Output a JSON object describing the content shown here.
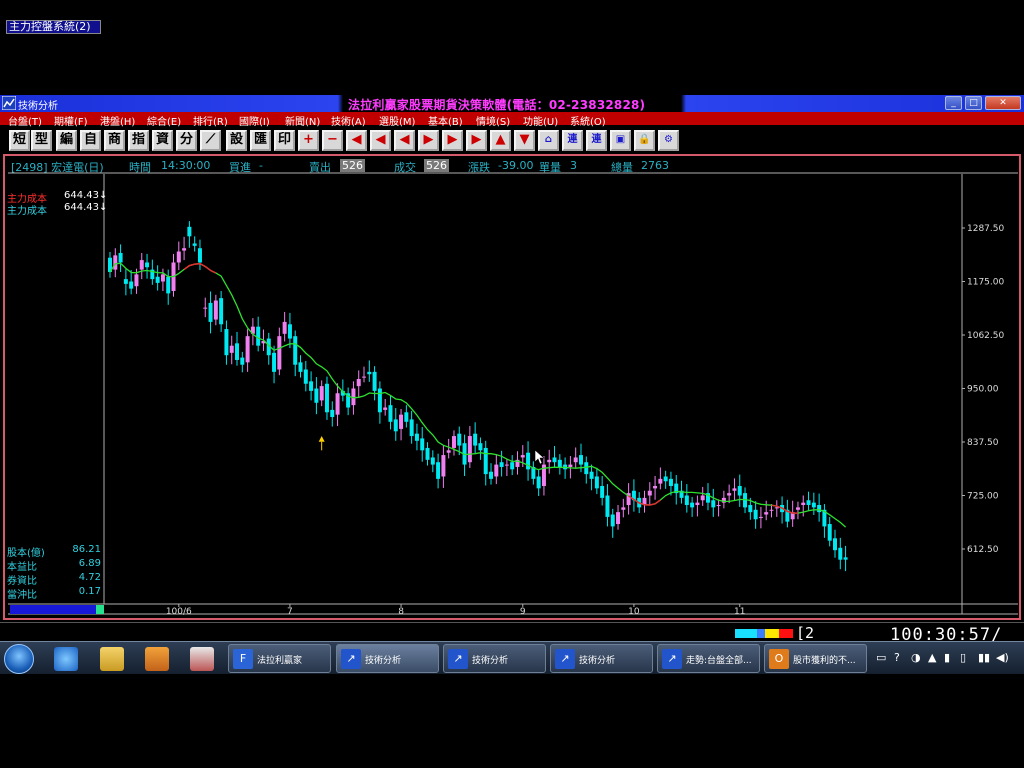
{
  "window": {
    "title": "技術分析",
    "banner": "法拉利贏家股票期貨決策軟體(電話：02-23832828)",
    "min_icon": "_",
    "max_icon": "□",
    "close_icon": "✕"
  },
  "menu": [
    {
      "label": "台盤(T)",
      "x": 8
    },
    {
      "label": "期權(F)",
      "x": 54
    },
    {
      "label": "港盤(H)",
      "x": 100
    },
    {
      "label": "綜合(E)",
      "x": 147
    },
    {
      "label": "排行(R)",
      "x": 193
    },
    {
      "label": "國際(I)",
      "x": 239
    },
    {
      "label": "新聞(N)",
      "x": 285
    },
    {
      "label": "技術(A)",
      "x": 331
    },
    {
      "label": "選股(M)",
      "x": 379
    },
    {
      "label": "基本(B)",
      "x": 428
    },
    {
      "label": "情境(S)",
      "x": 476
    },
    {
      "label": "功能(U)",
      "x": 523
    },
    {
      "label": "系統(O)",
      "x": 570
    }
  ],
  "toolbar": [
    "短",
    "型",
    "編",
    "自",
    "商",
    "指",
    "資",
    "分",
    "⟋",
    "設",
    "匯",
    "印",
    "+",
    "−",
    "◀",
    "◀",
    "◀",
    "▶",
    "▶",
    "▶",
    "▲",
    "▼",
    "⌂",
    "連",
    "連",
    "▣",
    "🔒",
    "⚙"
  ],
  "info": {
    "stock": "[2498] 宏達電(日)",
    "time_label": "時間",
    "time": "14:30:00",
    "bid_label": "買進",
    "bid": "-",
    "ask_label": "賣出",
    "ask": "526",
    "deal_label": "成交",
    "deal": "526",
    "change_label": "漲跌",
    "change": "-39.00",
    "vol_label": "單量",
    "vol": "3",
    "total_label": "總量",
    "total": "2763"
  },
  "indicator": {
    "title": "主力控盤系統(2)",
    "rows": [
      {
        "label": "主力成本",
        "value": "644.43↓"
      },
      {
        "label": "主力成本",
        "value": "644.43↓"
      }
    ]
  },
  "stats": [
    {
      "label": "股本(億)",
      "value": "86.21"
    },
    {
      "label": "本益比",
      "value": "6.89"
    },
    {
      "label": "券資比",
      "value": "4.72"
    },
    {
      "label": "當沖比",
      "value": "0.17"
    }
  ],
  "status": {
    "text": "[2_",
    "clock": "100:30:57/"
  },
  "taskbar": {
    "tasks": [
      {
        "label": "法拉利贏家",
        "x": 228,
        "color": "#2a64d6",
        "icon": "F"
      },
      {
        "label": "技術分析",
        "x": 336,
        "color": "#2255cc",
        "icon": "↗"
      },
      {
        "label": "技術分析",
        "x": 443,
        "color": "#2255cc",
        "icon": "↗"
      },
      {
        "label": "技術分析",
        "x": 550,
        "color": "#2255cc",
        "icon": "↗"
      },
      {
        "label": "走勢:台盤全部...",
        "x": 657,
        "color": "#2255cc",
        "icon": "↗"
      },
      {
        "label": "股市獲利的不...",
        "x": 764,
        "color": "#e07b1c",
        "icon": "O"
      }
    ],
    "tray": [
      "▭",
      "?",
      "◑",
      "▲",
      "▮",
      "▯",
      "▮▮",
      "◀)"
    ]
  },
  "colors": {
    "up": "#f080f0",
    "down": "#00e8f0",
    "ma": "#2ee02e",
    "ma_red": "#e03030",
    "axis": "#b0b0b0"
  },
  "chart_data": {
    "type": "candlestick",
    "ylim": [
      560,
      1330
    ],
    "yticks": [
      "1287.50",
      "1175.00",
      "1062.50",
      "950.00",
      "837.50",
      "725.00",
      "612.50"
    ],
    "xticks": [
      {
        "label": "100/6",
        "i": 13
      },
      {
        "label": "7",
        "i": 34
      },
      {
        "label": "8",
        "i": 55
      },
      {
        "label": "9",
        "i": 78
      },
      {
        "label": "10",
        "i": 99
      },
      {
        "label": "11",
        "i": 119
      }
    ],
    "count": 138,
    "closes": [
      1195,
      1230,
      1215,
      1170,
      1160,
      1190,
      1220,
      1205,
      1180,
      1172,
      1190,
      1150,
      1215,
      1238,
      1245,
      1270,
      1250,
      1215,
      1120,
      1090,
      1135,
      1085,
      1020,
      1040,
      1010,
      1000,
      1060,
      1080,
      1040,
      1050,
      1020,
      985,
      1060,
      1090,
      1055,
      1000,
      985,
      960,
      945,
      920,
      955,
      900,
      890,
      940,
      935,
      910,
      950,
      970,
      975,
      980,
      945,
      900,
      910,
      880,
      860,
      895,
      880,
      850,
      840,
      820,
      800,
      790,
      760,
      810,
      820,
      850,
      830,
      790,
      850,
      830,
      820,
      770,
      760,
      790,
      785,
      790,
      780,
      800,
      810,
      780,
      760,
      740,
      790,
      800,
      795,
      785,
      780,
      790,
      805,
      790,
      770,
      760,
      740,
      720,
      680,
      660,
      690,
      700,
      730,
      715,
      700,
      720,
      735,
      745,
      760,
      755,
      745,
      730,
      720,
      705,
      700,
      710,
      725,
      710,
      700,
      705,
      720,
      730,
      740,
      725,
      700,
      690,
      675,
      680,
      690,
      695,
      700,
      690,
      670,
      690,
      700,
      710,
      705,
      700,
      690,
      660,
      630,
      610,
      590,
      590
    ],
    "opens": [
      1225,
      1200,
      1235,
      1180,
      1175,
      1165,
      1200,
      1215,
      1200,
      1185,
      1175,
      1185,
      1155,
      1215,
      1240,
      1290,
      1255,
      1245,
      1120,
      1130,
      1095,
      1140,
      1075,
      1025,
      1045,
      1015,
      1005,
      1065,
      1080,
      1045,
      1055,
      1025,
      990,
      1065,
      1085,
      1060,
      1005,
      990,
      965,
      950,
      925,
      960,
      905,
      895,
      945,
      940,
      915,
      955,
      975,
      985,
      985,
      950,
      905,
      915,
      885,
      865,
      900,
      885,
      855,
      845,
      825,
      805,
      795,
      765,
      815,
      825,
      855,
      835,
      795,
      855,
      835,
      825,
      775,
      765,
      795,
      790,
      795,
      785,
      805,
      815,
      785,
      765,
      745,
      795,
      805,
      800,
      790,
      785,
      795,
      810,
      795,
      775,
      765,
      745,
      725,
      685,
      665,
      695,
      705,
      735,
      720,
      705,
      725,
      740,
      750,
      765,
      760,
      750,
      735,
      725,
      710,
      705,
      715,
      730,
      715,
      705,
      710,
      725,
      735,
      745,
      730,
      705,
      695,
      680,
      685,
      695,
      700,
      705,
      695,
      675,
      695,
      705,
      715,
      710,
      705,
      695,
      665,
      635,
      615,
      595
    ]
  }
}
